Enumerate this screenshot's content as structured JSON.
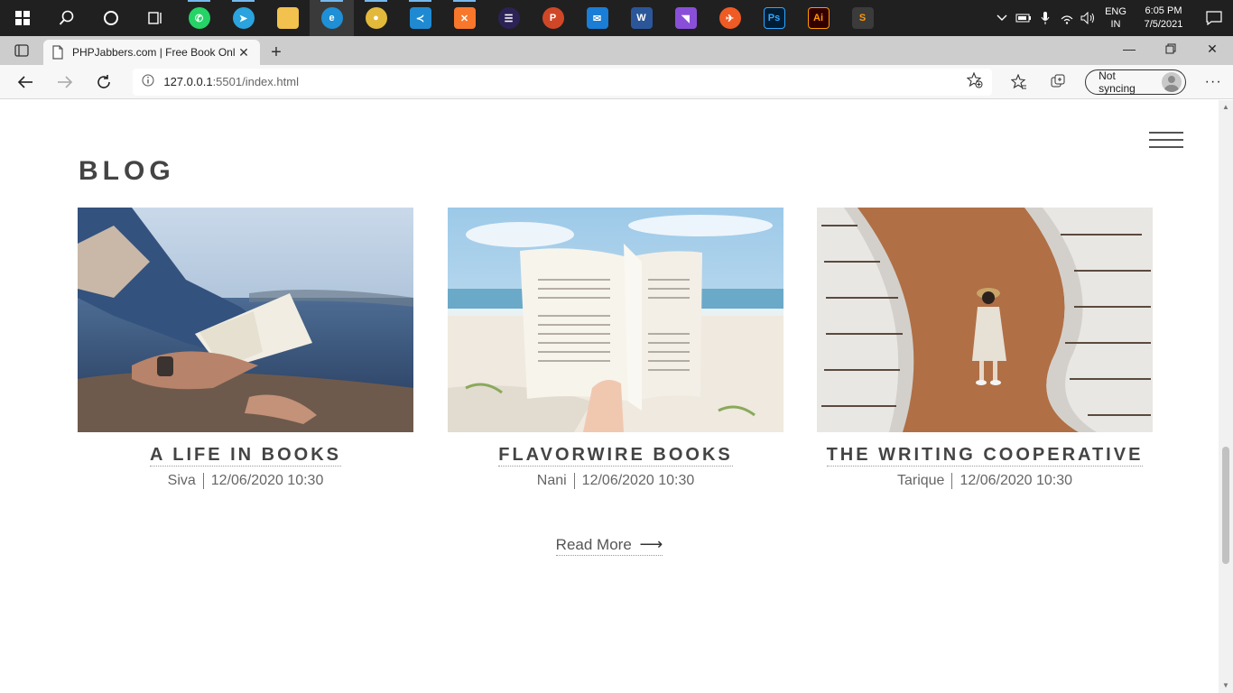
{
  "taskbar": {
    "apps": [
      {
        "name": "whatsapp",
        "glyph": "✆",
        "color": "#25d366"
      },
      {
        "name": "telegram",
        "glyph": "➤",
        "color": "#2aa3de"
      },
      {
        "name": "file-explorer",
        "glyph": "",
        "color": "#f2c14e"
      },
      {
        "name": "edge",
        "glyph": "e",
        "color": "#1f8fd6"
      },
      {
        "name": "chrome",
        "glyph": "●",
        "color": "#e2b93b"
      },
      {
        "name": "vscode",
        "glyph": "≺",
        "color": "#1f8ad2"
      },
      {
        "name": "xampp",
        "glyph": "✕",
        "color": "#f8772b"
      },
      {
        "name": "eclipse",
        "glyph": "☰",
        "color": "#2c2255"
      },
      {
        "name": "powerpoint",
        "glyph": "P",
        "color": "#d04727"
      },
      {
        "name": "mail",
        "glyph": "✉",
        "color": "#1a7dd6"
      },
      {
        "name": "word",
        "glyph": "W",
        "color": "#2b579a"
      },
      {
        "name": "visual-studio",
        "glyph": "◥",
        "color": "#8a4fd8"
      },
      {
        "name": "postman",
        "glyph": "✈",
        "color": "#ef5b25"
      },
      {
        "name": "photoshop",
        "glyph": "Ps",
        "color": "#001d34"
      },
      {
        "name": "illustrator",
        "glyph": "Ai",
        "color": "#330000"
      },
      {
        "name": "sublime-text",
        "glyph": "S",
        "color": "#3b3b3b"
      }
    ],
    "lang_top": "ENG",
    "lang_bottom": "IN",
    "time": "6:05 PM",
    "date": "7/5/2021"
  },
  "browser": {
    "tab_title": "PHPJabbers.com | Free Book Onli",
    "url_host": "127.0.0.1",
    "url_path": ":5501/index.html",
    "sync_label": "Not syncing"
  },
  "page": {
    "section_title": "BLOG",
    "posts": [
      {
        "title": "A LIFE IN BOOKS",
        "author": "Siva",
        "date": "12/06/2020 10:30"
      },
      {
        "title": "FLAVORWIRE BOOKS",
        "author": "Nani",
        "date": "12/06/2020 10:30"
      },
      {
        "title": "THE WRITING COOPERATIVE",
        "author": "Tarique",
        "date": "12/06/2020 10:30"
      }
    ],
    "read_more": "Read More",
    "read_more_arrow": "⟶"
  }
}
